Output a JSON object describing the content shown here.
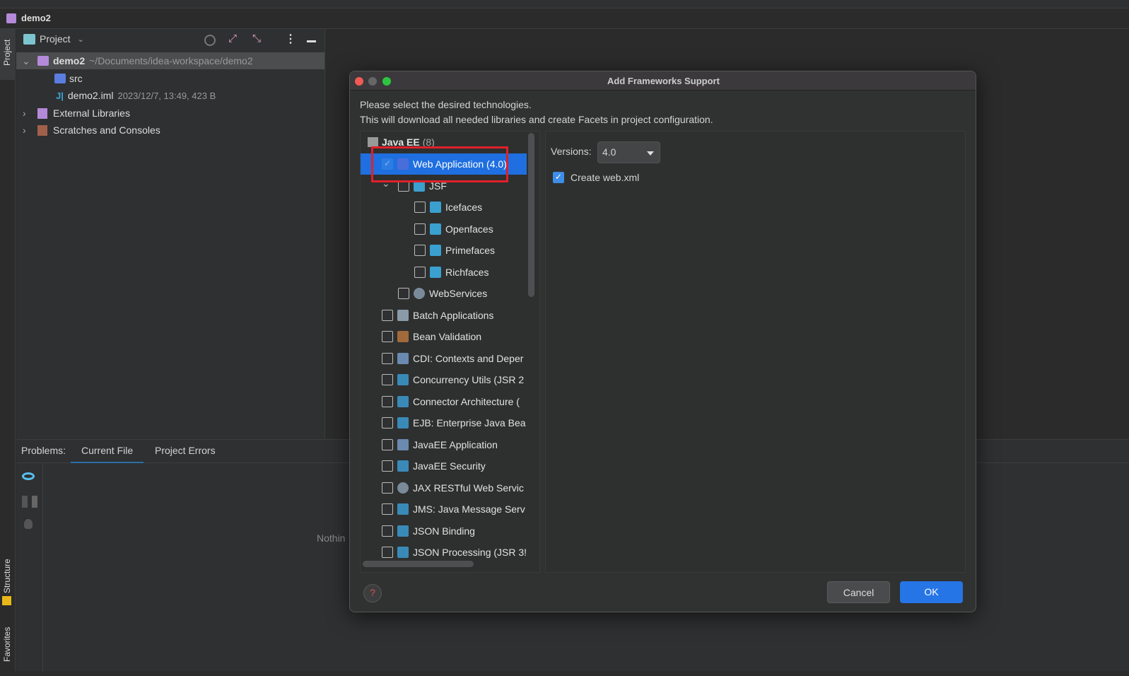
{
  "window": {
    "project_name": "demo2"
  },
  "sidebar_tabs": {
    "project": "Project",
    "structure": "Structure",
    "favorites": "Favorites"
  },
  "project_panel": {
    "selector": "Project",
    "tree": [
      {
        "name": "demo2",
        "detail": "~/Documents/idea-workspace/demo2",
        "expanded": true
      },
      {
        "name": "src"
      },
      {
        "name": "demo2.iml",
        "detail": "2023/12/7, 13:49, 423 B"
      },
      {
        "name": "External Libraries"
      },
      {
        "name": "Scratches and Consoles"
      }
    ]
  },
  "problems": {
    "label": "Problems:",
    "tabs": [
      "Current File",
      "Project Errors"
    ],
    "active_tab": "Current File",
    "empty_text": "Nothin"
  },
  "dialog": {
    "title": "Add Frameworks Support",
    "intro1": "Please select the desired technologies.",
    "intro2": "This will download all needed libraries and create Facets in project configuration.",
    "group": {
      "name": "Java EE",
      "count": "(8)"
    },
    "items": [
      {
        "label": "Web Application (4.0)",
        "checked": true,
        "selected": true,
        "level": 1,
        "icon": "web-app-icon"
      },
      {
        "label": "JSF",
        "checked": false,
        "level": 2,
        "icon": "jsf-icon",
        "expandable": true
      },
      {
        "label": "Icefaces",
        "checked": false,
        "level": 3,
        "icon": "jsf-icon"
      },
      {
        "label": "Openfaces",
        "checked": false,
        "level": 3,
        "icon": "jsf-icon"
      },
      {
        "label": "Primefaces",
        "checked": false,
        "level": 3,
        "icon": "jsf-icon"
      },
      {
        "label": "Richfaces",
        "checked": false,
        "level": 3,
        "icon": "jsf-icon"
      },
      {
        "label": "WebServices",
        "checked": false,
        "level": 2,
        "icon": "gear-icon"
      },
      {
        "label": "Batch Applications",
        "checked": false,
        "level": 1,
        "icon": "batch-icon"
      },
      {
        "label": "Bean Validation",
        "checked": false,
        "level": 1,
        "icon": "bean-icon"
      },
      {
        "label": "CDI: Contexts and Deper",
        "checked": false,
        "level": 1,
        "icon": "cdi-icon"
      },
      {
        "label": "Concurrency Utils (JSR 2",
        "checked": false,
        "level": 1,
        "icon": "javaee-icon"
      },
      {
        "label": "Connector Architecture (",
        "checked": false,
        "level": 1,
        "icon": "javaee-icon"
      },
      {
        "label": "EJB: Enterprise Java Bea",
        "checked": false,
        "level": 1,
        "icon": "javaee-icon"
      },
      {
        "label": "JavaEE Application",
        "checked": false,
        "level": 1,
        "icon": "javaee-app-icon"
      },
      {
        "label": "JavaEE Security",
        "checked": false,
        "level": 1,
        "icon": "javaee-icon"
      },
      {
        "label": "JAX RESTful Web Servic",
        "checked": false,
        "level": 1,
        "icon": "gear-icon"
      },
      {
        "label": "JMS: Java Message Serv",
        "checked": false,
        "level": 1,
        "icon": "javaee-icon"
      },
      {
        "label": "JSON Binding",
        "checked": false,
        "level": 1,
        "icon": "javaee-icon"
      },
      {
        "label": "JSON Processing (JSR 3!",
        "checked": false,
        "level": 1,
        "icon": "javaee-icon"
      }
    ],
    "versions_label": "Versions:",
    "version_value": "4.0",
    "create_webxml_label": "Create web.xml",
    "create_webxml_checked": true,
    "cancel": "Cancel",
    "ok": "OK"
  },
  "colors": {
    "accent": "#2675e6",
    "selection": "#1f6fe0",
    "highlight_box": "#e0202a"
  }
}
